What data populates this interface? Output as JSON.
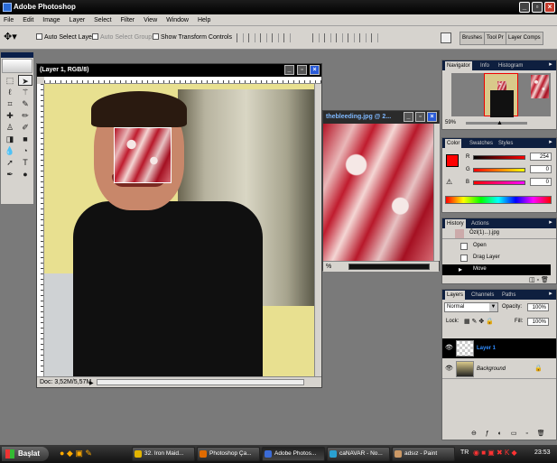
{
  "app": {
    "title": "Adobe Photoshop"
  },
  "menu": [
    "File",
    "Edit",
    "Image",
    "Layer",
    "Select",
    "Filter",
    "View",
    "Window",
    "Help"
  ],
  "options": {
    "auto_select_layer": "Auto Select Layer",
    "auto_select_groups": "Auto Select Groups",
    "show_transform_controls": "Show Transform Controls",
    "well_tabs": [
      "Brushes",
      "Tool Pr",
      "Layer Comps"
    ]
  },
  "doc_main": {
    "title": "(Layer 1, RGB/8)",
    "status": "Doc: 3,52M/5,57M"
  },
  "doc_second": {
    "title": "thebleeding.jpg @ 2...",
    "zoom": "%"
  },
  "navigator": {
    "tabs": [
      "Navigator",
      "Info",
      "Histogram"
    ],
    "zoom": "59%"
  },
  "color": {
    "tabs": [
      "Color",
      "Swatches",
      "Styles"
    ],
    "r_label": "R",
    "g_label": "G",
    "b_label": "B",
    "r": "254",
    "g": "0",
    "b": "0",
    "foreground": "#fe0000",
    "background": "#000000"
  },
  "history": {
    "tabs": [
      "History",
      "Actions"
    ],
    "snapshot": "Ôzl(1)...).jpg",
    "items": [
      "Open",
      "Drag Layer",
      "Move"
    ]
  },
  "layers": {
    "tabs": [
      "Layers",
      "Channels",
      "Paths"
    ],
    "blend_mode": "Normal",
    "opacity_label": "Opacity:",
    "opacity": "100%",
    "lock_label": "Lock:",
    "fill_label": "Fill:",
    "fill": "100%",
    "items": [
      {
        "name": "Layer 1",
        "selected": true
      },
      {
        "name": "Background",
        "selected": false
      }
    ]
  },
  "taskbar": {
    "start": "Başlat",
    "tasks": [
      "32. Iron Maid...",
      "Photoshop Ça...",
      "Adobe Photos...",
      "caNAVAR - No...",
      "adsız - Paint"
    ],
    "lang": "TR",
    "clock": "23:53"
  }
}
